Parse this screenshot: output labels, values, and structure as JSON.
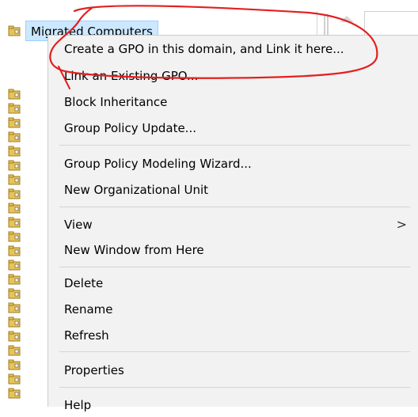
{
  "tree": {
    "selected_node": "Migrated Computers",
    "node_count": 20
  },
  "context_menu": {
    "items": [
      {
        "label": "Create a GPO in this domain, and Link it here...",
        "has_submenu": false
      },
      {
        "label": "Link an Existing GPO...",
        "has_submenu": false
      },
      {
        "label": "Block Inheritance",
        "has_submenu": false
      },
      {
        "label": "Group Policy Update...",
        "has_submenu": false
      },
      {
        "label": "Group Policy Modeling Wizard...",
        "has_submenu": false
      },
      {
        "label": "New Organizational Unit",
        "has_submenu": false
      },
      {
        "label": "View",
        "has_submenu": true
      },
      {
        "label": "New Window from Here",
        "has_submenu": false
      },
      {
        "label": "Delete",
        "has_submenu": false
      },
      {
        "label": "Rename",
        "has_submenu": false
      },
      {
        "label": "Refresh",
        "has_submenu": false
      },
      {
        "label": "Properties",
        "has_submenu": false
      },
      {
        "label": "Help",
        "has_submenu": false
      }
    ],
    "submenu_glyph": ">"
  },
  "colors": {
    "menu_background": "#f2f2f2",
    "selection_background": "#cce8ff",
    "annotation_red": "#e32020",
    "folder_yellow": "#e8c35a"
  },
  "icons": {
    "ou": "organizational-unit-icon"
  }
}
